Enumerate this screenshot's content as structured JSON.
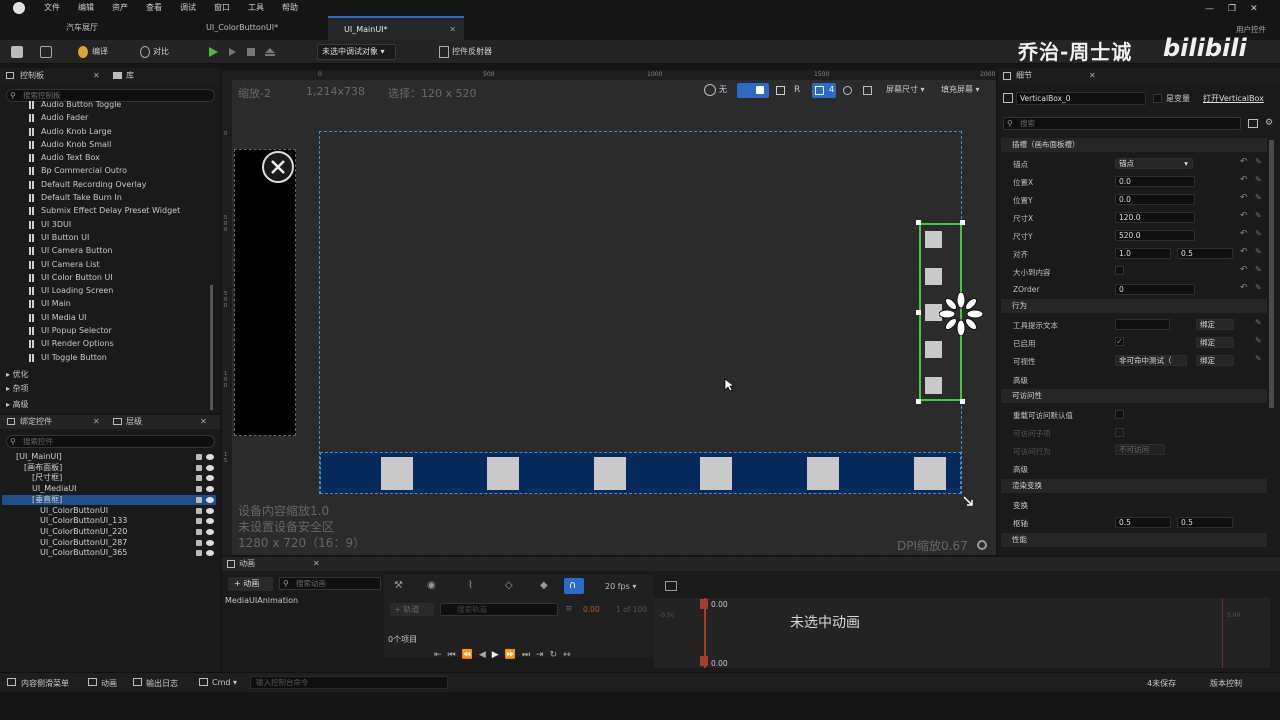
{
  "menu": [
    "文件",
    "编辑",
    "资产",
    "查看",
    "调试",
    "窗口",
    "工具",
    "帮助"
  ],
  "tabs": [
    {
      "label": "汽车展厅"
    },
    {
      "label": "UI_ColorButtonUI*"
    },
    {
      "label": "UI_MainUI*"
    }
  ],
  "window_extra": "用户控件",
  "toolbar": {
    "compile": "编译",
    "diff": "对比",
    "debug_target": "未选中调试对象",
    "widget_reflector": "控件反射器"
  },
  "watermark": {
    "name": "乔治-周士诚",
    "site": "bilibili"
  },
  "left_panel": {
    "tabs": [
      "控制板",
      "库"
    ],
    "search_placeholder": "搜索控制板",
    "items": [
      "Audio Button Toggle",
      "Audio Fader",
      "Audio Knob Large",
      "Audio Knob Small",
      "Audio Text Box",
      "Bp Commercial Outro",
      "Default Recording Overlay",
      "Default Take Burn In",
      "Submix Effect Delay Preset Widget",
      "UI 3DUI",
      "UI Button UI",
      "UI Camera Button",
      "UI Camera List",
      "UI Color Button UI",
      "UI Loading Screen",
      "UI Main",
      "UI Media UI",
      "UI Popup Selector",
      "UI Render Options",
      "UI Toggle Button"
    ],
    "categories": [
      "优化",
      "杂项",
      "高级"
    ]
  },
  "hierarchy_panel": {
    "tabs": [
      "绑定控件",
      "层级"
    ],
    "search_placeholder": "搜索控件",
    "items": [
      {
        "label": "[UI_MainUI]",
        "indent": 0
      },
      {
        "label": "[画布面板]",
        "indent": 1
      },
      {
        "label": "[尺寸框]",
        "indent": 2
      },
      {
        "label": "UI_MediaUI",
        "indent": 2
      },
      {
        "label": "[垂直框]",
        "indent": 2,
        "selected": true
      },
      {
        "label": "UI_ColorButtonUI",
        "indent": 3
      },
      {
        "label": "UI_ColorButtonUI_133",
        "indent": 3
      },
      {
        "label": "UI_ColorButtonUI_220",
        "indent": 3
      },
      {
        "label": "UI_ColorButtonUI_287",
        "indent": 3
      },
      {
        "label": "UI_ColorButtonUI_365",
        "indent": 3
      }
    ]
  },
  "viewport": {
    "zoom": "缩放-2",
    "resolution": "1,214x738",
    "selection": "选择：120 x 520",
    "ruler": [
      "0",
      "500",
      "1000",
      "1500",
      "2000"
    ],
    "vruler": [
      "0",
      "5",
      "0",
      "0",
      "5",
      "0",
      "0",
      "1",
      "0",
      "0",
      "1",
      "5"
    ],
    "toggles": {
      "none": "无",
      "r": "R",
      "grid": "4"
    },
    "screen_size": "屏幕尺寸",
    "fill_screen": "填充屏幕",
    "info_lines": [
      "设备内容缩放1.0",
      "未设置设备安全区",
      "1280 x 720（16：9）"
    ],
    "dpi": "DPI缩放0.67"
  },
  "details": {
    "tab": "细节",
    "name": "VerticalBox_0",
    "is_variable": "是变量",
    "open_link": "打开VerticalBox",
    "search_placeholder": "搜索",
    "slot_section": "插槽（画布面板槽）",
    "rows": [
      {
        "label": "锚点",
        "value": "锚点"
      },
      {
        "label": "位置X",
        "value": "0.0"
      },
      {
        "label": "位置Y",
        "value": "0.0"
      },
      {
        "label": "尺寸X",
        "value": "120.0"
      },
      {
        "label": "尺寸Y",
        "value": "520.0"
      },
      {
        "label": "对齐",
        "value": "1.0",
        "value2": "0.5"
      },
      {
        "label": "大小到内容",
        "value": ""
      },
      {
        "label": "ZOrder",
        "value": "0"
      }
    ],
    "behavior_section": "行为",
    "behavior_rows": [
      {
        "label": "工具提示文本",
        "bind": "绑定"
      },
      {
        "label": "已启用",
        "bind": "绑定"
      },
      {
        "label": "可视性",
        "value": "非可命中测试（",
        "bind": "绑定"
      }
    ],
    "advanced": "高级",
    "access_section": "可访问性",
    "access_rows": [
      {
        "label": "重载可访问默认值"
      },
      {
        "label": "可访问子项"
      },
      {
        "label": "可访问行为",
        "value": "不可访问"
      }
    ],
    "advanced2": "高级",
    "render_section": "渲染变换",
    "transform": "变换",
    "pivot": {
      "label": "枢轴",
      "x": "0.5",
      "y": "0.5"
    },
    "perf": "性能"
  },
  "anim": {
    "tab": "动画",
    "add": "+ 动画",
    "search_placeholder": "搜索动画",
    "items": [
      "MediaUIAnimation"
    ],
    "fps": "20 fps",
    "track": "+ 轨道",
    "filter_placeholder": "搜索轨道",
    "time": "0.00",
    "of": "1 of 100",
    "count": "0个项目",
    "empty": "未选中动画",
    "t0": "0.00",
    "t1": "0.00",
    "tl_left": "-0.50",
    "tl_right": "5.00"
  },
  "status": {
    "drawer": "内容侧滑菜单",
    "anim": "动画",
    "log": "输出日志",
    "cmd": "Cmd",
    "cmd_placeholder": "输入控制台命令",
    "unsaved": "4未保存",
    "source": "版本控制"
  },
  "colors": {
    "accent": "#2a6ac9",
    "select_blue": "#3d8fd6",
    "select_green": "#3fc93f",
    "bar_blue": "#072a5c",
    "play_green": "#4cbc32"
  }
}
